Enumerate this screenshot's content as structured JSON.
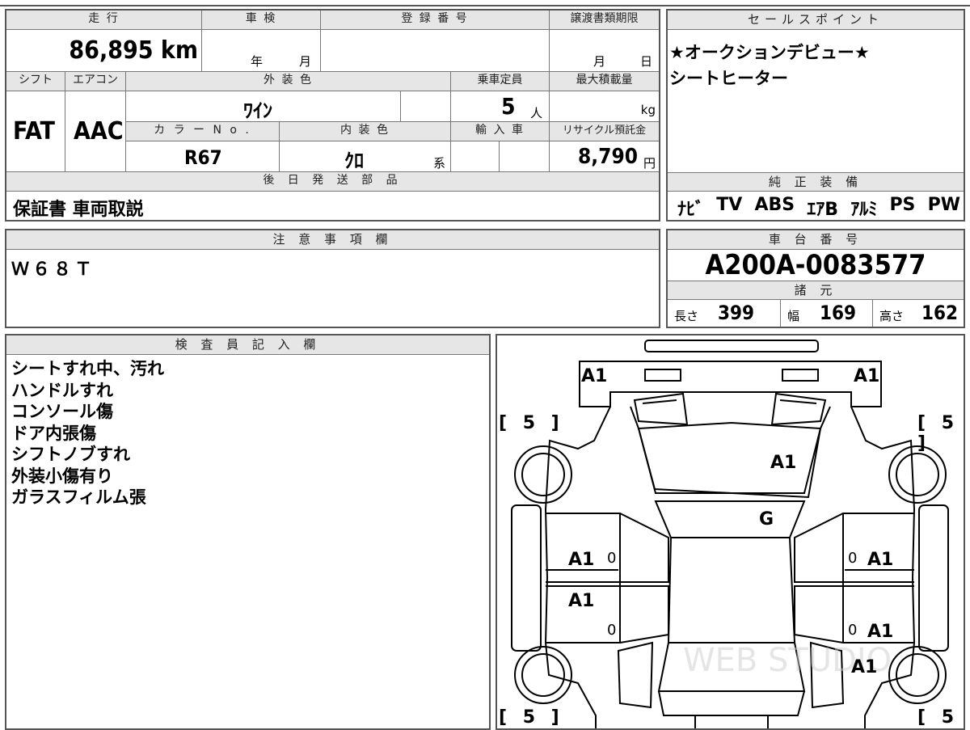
{
  "vehicle": {
    "mileage_label": "走 行",
    "mileage": "86,895 km",
    "inspection_label": "車 検",
    "inspection_year": "年",
    "inspection_month": "月",
    "registration_label": "登 録 番 号",
    "transfer_deadline_label": "譲渡書類期限",
    "transfer_month": "月",
    "transfer_day": "日",
    "shift_label": "シフト",
    "shift": "FAT",
    "aircon_label": "エアコン",
    "aircon": "AAC",
    "exterior_color_label": "外 装 色",
    "exterior_color": "ﾜｲﾝ",
    "color_no_label": "カ ラ ー N o .",
    "color_no": "R67",
    "interior_color_label": "内 装 色",
    "interior_color": "ｸﾛ",
    "interior_suffix": "系",
    "capacity_label": "乗車定員",
    "capacity": "5",
    "capacity_unit": "人",
    "max_load_label": "最大積載量",
    "max_load_unit": "kg",
    "import_label": "輸 入 車",
    "recycle_label": "リサイクル預託金",
    "recycle_fee": "8,790",
    "recycle_unit": "円"
  },
  "sales_points": {
    "label": "セールスポイント",
    "lines": [
      "★オークションデビュー★",
      "シートヒーター"
    ]
  },
  "later_parts": {
    "label": "後 日 発 送 部 品",
    "value": "保証書 車両取説"
  },
  "equipment": {
    "label": "純 正 装 備",
    "items": [
      "ﾅﾋﾞ",
      "TV",
      "ABS",
      "ｴｱB",
      "ｱﾙﾐ",
      "PS",
      "PW"
    ]
  },
  "notes": {
    "label": "注 意 事 項 欄",
    "value": "Ｗ６８Ｔ"
  },
  "chassis": {
    "label": "車 台 番 号",
    "value": "A200A-0083577"
  },
  "specs": {
    "label": "諸 元",
    "length_label": "長さ",
    "length": "399",
    "width_label": "幅",
    "width": "169",
    "height_label": "高さ",
    "height": "162"
  },
  "inspector": {
    "label": "検 査 員 記 入 欄",
    "lines": [
      "シートすれ中、汚れ",
      "ハンドルすれ",
      "コンソール傷",
      "ドア内張傷",
      "シフトノブすれ",
      "外装小傷有り",
      "ガラスフィルム張"
    ]
  },
  "diagram": {
    "marks": {
      "front_left": "A1",
      "front_right": "A1",
      "windshield": "A1",
      "roof_glass": "G",
      "left_front_door": "A1",
      "left_rear_door": "A1",
      "right_front_door": "A1",
      "right_rear_door": "A1",
      "right_rear_quarter": "A1",
      "tire_fl": "[ 5 ]",
      "tire_fr": "[ 5 ]",
      "tire_rl": "[ 5 ]",
      "tire_rr": "[ 5 ]",
      "zero_lf": "0",
      "zero_lr": "0",
      "zero_rf": "0",
      "zero_rr": "0"
    },
    "watermark": "WEB STUDIO"
  }
}
